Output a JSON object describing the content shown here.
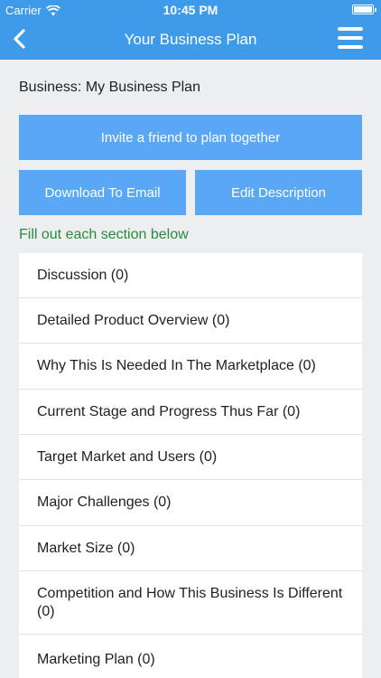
{
  "status_bar": {
    "carrier": "Carrier",
    "time": "10:45 PM"
  },
  "nav": {
    "title": "Your Business Plan",
    "back_icon": "chevron-left-icon",
    "menu_icon": "hamburger-menu-icon"
  },
  "business": {
    "label": "Business: My Business Plan"
  },
  "buttons": {
    "invite": "Invite a friend to plan together",
    "download": "Download To Email",
    "edit": "Edit Description"
  },
  "hint": "Fill out each section below",
  "sections": [
    "Discussion (0)",
    "Detailed Product Overview (0)",
    "Why This Is Needed In The Marketplace (0)",
    "Current Stage and Progress Thus Far (0)",
    "Target Market and Users (0)",
    "Major Challenges (0)",
    "Market Size (0)",
    "Competition and How This Business Is Different (0)",
    "Marketing Plan (0)"
  ],
  "colors": {
    "nav_bar": "#3d9be9",
    "button": "#5aa8f5",
    "hint": "#2b8a3e"
  }
}
